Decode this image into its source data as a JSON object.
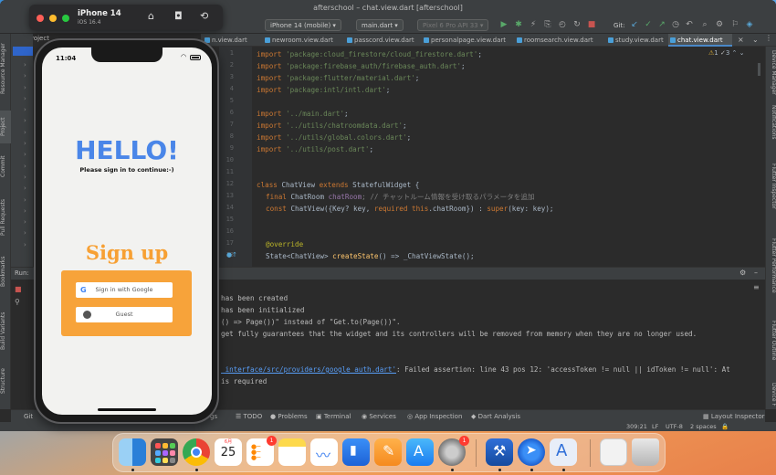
{
  "ide": {
    "window_title": "afterschool – chat.view.dart [afterschool]",
    "project_short": "afte",
    "device_select": "iPhone 14 (mobile)",
    "run_config": "main.dart",
    "emulator": "Pixel 6 Pro API 33",
    "git_label": "Git:",
    "project_label": "Project",
    "tabs": [
      "n.view.dart",
      "newroom.view.dart",
      "passcord.view.dart",
      "personalpage.view.dart",
      "roomsearch.view.dart",
      "study.view.dart",
      "chat.view.dart"
    ],
    "warnings": "1",
    "errors": "3",
    "left_tools": [
      "Resource Manager",
      "Project",
      "Commit",
      "Pull Requests",
      "Bookmarks",
      "Build Variants",
      "Structure"
    ],
    "right_tools": [
      "Device Manager",
      "Notifications",
      "Flutter Inspector",
      "Flutter Performance",
      "Flutter Outline",
      "Device F"
    ],
    "run_label": "Run:",
    "bottom_tabs": [
      "Git",
      "gs",
      "TODO",
      "Problems",
      "Terminal",
      "Services",
      "App Inspection",
      "Dart Analysis"
    ],
    "layout_inspector": "Layout Inspector",
    "status": {
      "position": "309:21",
      "line_ending": "LF",
      "encoding": "UTF-8",
      "indent": "2 spaces"
    }
  },
  "code": {
    "line_numbers": [
      "1",
      "2",
      "3",
      "4",
      "5",
      "6",
      "7",
      "8",
      "9",
      "10",
      "11",
      "12",
      "13",
      "14",
      "15",
      "16",
      "17",
      "18"
    ],
    "lines": [
      {
        "kw": "import ",
        "str": "'package:cloud_firestore/cloud_firestore.dart'",
        "rest": ";"
      },
      {
        "kw": "import ",
        "str": "'package:firebase_auth/firebase_auth.dart'",
        "rest": ";"
      },
      {
        "kw": "import ",
        "str": "'package:flutter/material.dart'",
        "rest": ";"
      },
      {
        "kw": "import ",
        "str": "'package:intl/intl.dart'",
        "rest": ";"
      },
      {
        "kw": "import ",
        "str": "'../main.dart'",
        "rest": ";"
      },
      {
        "kw": "import ",
        "str": "'../utils/chatroomdata.dart'",
        "rest": ";"
      },
      {
        "kw": "import ",
        "str": "'../utils/global.colors.dart'",
        "rest": ";"
      },
      {
        "kw": "import ",
        "str": "'../utils/post.dart'",
        "rest": ";"
      }
    ],
    "class_line": {
      "kw1": "class ",
      "name": "ChatView ",
      "kw2": "extends ",
      "base": "StatefulWidget {"
    },
    "field_line": {
      "kw": "final ",
      "type": "ChatRoom ",
      "name": "chatRoom",
      "comment": "; // チャットルーム情報を受け取るパラメータを追加"
    },
    "ctor_line": {
      "kw": "const ",
      "text": "ChatView({Key? key, ",
      "req": "required ",
      "this": "this",
      "rest": ".chatRoom}) : ",
      "sup": "super",
      "end": "(key: key);"
    },
    "override": "@override",
    "state_line": {
      "type": "State<ChatView> ",
      "fn": "createState",
      "rest": "() => _ChatViewState();"
    }
  },
  "console": {
    "line1": "has been created",
    "line2": "has been initialized",
    "line3": "() => Page())\" instead of \"Get.to(Page())\".",
    "line4": "get fully guarantees that the widget and its controllers will be removed from memory when they are no longer used.",
    "error_link": "_interface/src/providers/google_auth.dart'",
    "error_rest": ": Failed assertion: line 43 pos 12: 'accessToken != null || idToken != null': At",
    "line6": "is required"
  },
  "simulator": {
    "device_name": "iPhone 14",
    "os_version": "iOS 16.4",
    "time": "11:04"
  },
  "app": {
    "hello": "HELLO!",
    "subtitle": "Please sign in to continue:-)",
    "signup_title": "Sign up",
    "google_button": "Sign in with Google",
    "guest_button": "Guest"
  },
  "dock": {
    "calendar_month": "6月",
    "calendar_day": "25",
    "badge_reminders": "1",
    "badge_settings": "1",
    "icons": [
      "finder-icon",
      "launchpad-icon",
      "chrome-icon",
      "calendar-icon",
      "reminders-icon",
      "notes-icon",
      "freeform-icon",
      "keynote-icon",
      "pages-icon",
      "app-store-icon",
      "system-settings-icon",
      "xcode-icon",
      "remote-icon",
      "instruments-icon",
      "file-icon",
      "trash-icon"
    ]
  },
  "colors": {
    "accent_blue": "#4a86e8",
    "accent_orange": "#f7a033",
    "ide_bg": "#2b2b2b"
  }
}
